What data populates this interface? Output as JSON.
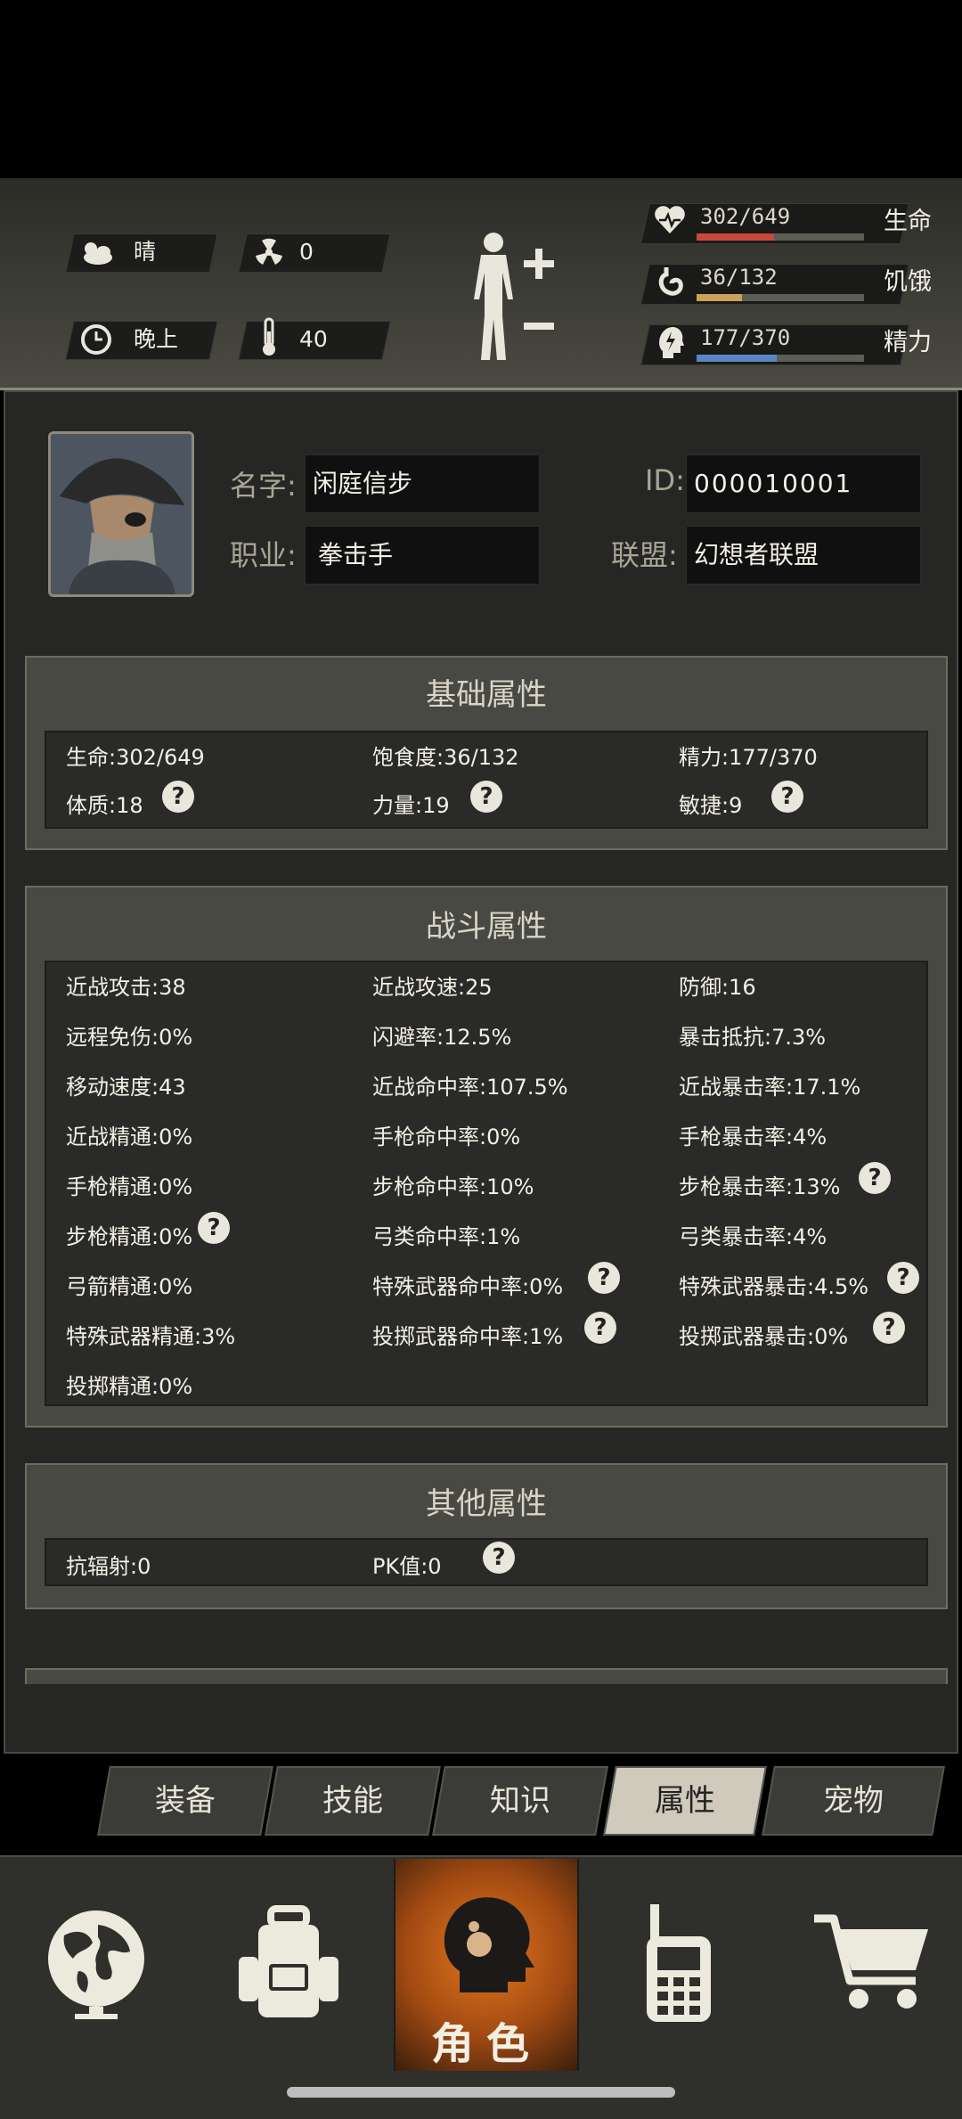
{
  "status": {
    "weather": "晴",
    "radiation": "0",
    "time_of_day": "晚上",
    "temperature": "40",
    "bars": [
      {
        "label": "生命",
        "value": "302/649",
        "fraction": 0.465,
        "color": "#c8493c",
        "icon": "heart-icon"
      },
      {
        "label": "饥饿",
        "value": "36/132",
        "fraction": 0.273,
        "color": "#caa25a",
        "icon": "stomach-icon"
      },
      {
        "label": "精力",
        "value": "177/370",
        "fraction": 0.478,
        "color": "#5b86c4",
        "icon": "energy-head-icon"
      }
    ]
  },
  "profile": {
    "name_label": "名字:",
    "name": "闲庭信步",
    "id_label": "ID:",
    "id": "000010001",
    "job_label": "职业:",
    "job": "拳击手",
    "alliance_label": "联盟:",
    "alliance": "幻想者联盟"
  },
  "basic": {
    "title": "基础属性",
    "stats": [
      "生命:302/649",
      "饱食度:36/132",
      "精力:177/370",
      "体质:18",
      "力量:19",
      "敏捷:9"
    ]
  },
  "combat": {
    "title": "战斗属性",
    "stats": [
      "近战攻击:38",
      "近战攻速:25",
      "防御:16",
      "远程免伤:0%",
      "闪避率:12.5%",
      "暴击抵抗:7.3%",
      "移动速度:43",
      "近战命中率:107.5%",
      "近战暴击率:17.1%",
      "近战精通:0%",
      "手枪命中率:0%",
      "手枪暴击率:4%",
      "手枪精通:0%",
      "步枪命中率:10%",
      "步枪暴击率:13%",
      "步枪精通:0%",
      "弓类命中率:1%",
      "弓类暴击率:4%",
      "弓箭精通:0%",
      "特殊武器命中率:0%",
      "特殊武器暴击:4.5%",
      "特殊武器精通:3%",
      "投掷武器命中率:1%",
      "投掷武器暴击:0%",
      "投掷精通:0%"
    ]
  },
  "other": {
    "title": "其他属性",
    "stats": [
      "抗辐射:0",
      "PK值:0"
    ]
  },
  "help_symbol": "?",
  "tabs": [
    "装备",
    "技能",
    "知识",
    "属性",
    "宠物"
  ],
  "nav": {
    "role_label": "角色"
  }
}
